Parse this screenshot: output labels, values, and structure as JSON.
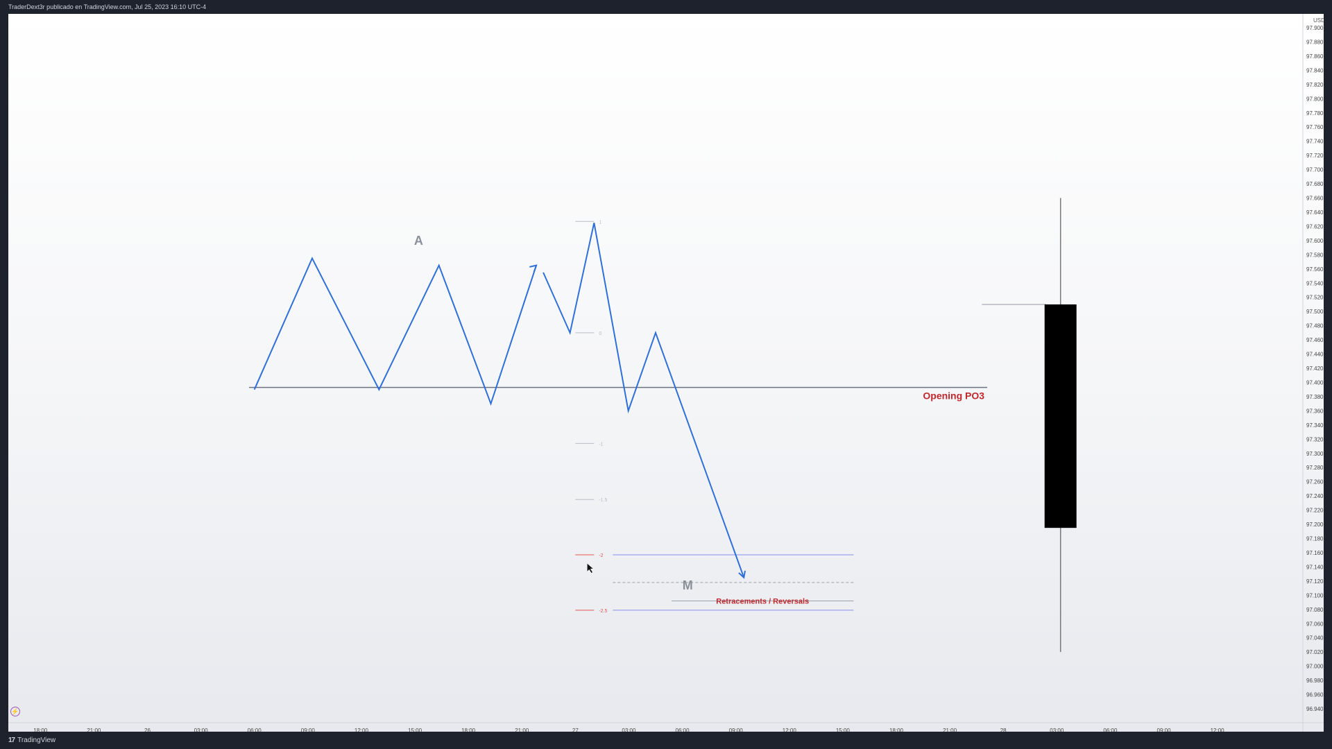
{
  "header": {
    "publish_text": "TraderDext3r publicado en TradingView.com, Jul 25, 2023 16:10 UTC-4"
  },
  "footer": {
    "brand": "TradingView",
    "logo_icon": "tradingview-logo-icon",
    "flash_icon": "lightning-icon"
  },
  "chart_data": {
    "type": "line",
    "currency": "USD",
    "y_ticks": [
      "97.900",
      "97.880",
      "97.860",
      "97.840",
      "97.820",
      "97.800",
      "97.780",
      "97.760",
      "97.740",
      "97.720",
      "97.700",
      "97.680",
      "97.660",
      "97.640",
      "97.620",
      "97.600",
      "97.580",
      "97.560",
      "97.540",
      "97.520",
      "97.500",
      "97.480",
      "97.460",
      "97.440",
      "97.420",
      "97.400",
      "97.380",
      "97.360",
      "97.340",
      "97.320",
      "97.300",
      "97.280",
      "97.260",
      "97.240",
      "97.220",
      "97.200",
      "97.180",
      "97.160",
      "97.140",
      "97.120",
      "97.100",
      "97.080",
      "97.060",
      "97.040",
      "97.020",
      "97.000",
      "96.980",
      "96.960",
      "96.940"
    ],
    "ylim": [
      96.94,
      97.9
    ],
    "x_ticks": [
      "18:00",
      "21:00",
      "26",
      "03:00",
      "06:00",
      "09:00",
      "12:00",
      "15:00",
      "18:00",
      "21:00",
      "27",
      "03:00",
      "06:00",
      "09:00",
      "12:00",
      "15:00",
      "18:00",
      "21:00",
      "28",
      "03:00",
      "06:00",
      "09:00",
      "12:00"
    ],
    "x_tick_index": [
      0,
      1,
      2,
      3,
      4,
      5,
      6,
      7,
      8,
      9,
      10,
      11,
      12,
      13,
      14,
      15,
      16,
      17,
      18,
      19,
      20,
      21,
      22
    ],
    "xlim": [
      -0.6,
      23.6
    ],
    "series": [
      {
        "color": "#2f6fd9",
        "points": [
          [
            4.0,
            97.39
          ],
          [
            5.08,
            97.575
          ],
          [
            6.33,
            97.39
          ],
          [
            7.45,
            97.565
          ],
          [
            8.42,
            97.37
          ],
          [
            9.27,
            97.565
          ]
        ]
      },
      {
        "color": "#2f6fd9",
        "points": [
          [
            9.4,
            97.555
          ],
          [
            9.9,
            97.47
          ],
          [
            10.35,
            97.625
          ],
          [
            10.99,
            97.36
          ],
          [
            11.5,
            97.47
          ],
          [
            13.15,
            97.125
          ]
        ]
      }
    ],
    "arrows": [
      {
        "from": [
          9.12,
          97.555
        ],
        "to": [
          9.27,
          97.565
        ]
      },
      {
        "from": [
          12.95,
          97.17
        ],
        "to": [
          13.15,
          97.125
        ]
      }
    ],
    "hlines": [
      {
        "y": 97.393,
        "x0": 3.9,
        "x1": 17.7,
        "color": "#6b7280",
        "label": "Opening PO3",
        "label_color": "#c0282d"
      }
    ],
    "fib_levels": [
      {
        "label": "1",
        "y": 97.627,
        "color": "#b8bcc4"
      },
      {
        "label": "0",
        "y": 97.47,
        "color": "#b8bcc4"
      },
      {
        "label": "-1",
        "y": 97.314,
        "color": "#b8bcc4"
      },
      {
        "label": "-1.5",
        "y": 97.235,
        "color": "#b8bcc4"
      },
      {
        "label": "-2",
        "y": 97.157,
        "color": "#e05555"
      },
      {
        "label": "-2.5",
        "y": 97.079,
        "color": "#e05555"
      }
    ],
    "fib_x": [
      10.0,
      10.35
    ],
    "zone_lines": [
      {
        "y": 97.157,
        "x0": 10.7,
        "x1": 15.2,
        "color": "#8c8ff0",
        "style": "solid"
      },
      {
        "y": 97.118,
        "x0": 10.7,
        "x1": 15.2,
        "color": "#9aa0a8",
        "style": "dashed"
      },
      {
        "y": 97.092,
        "x0": 11.8,
        "x1": 15.2,
        "color": "#9aa0a8",
        "style": "solid"
      },
      {
        "y": 97.079,
        "x0": 10.7,
        "x1": 15.2,
        "color": "#8c8ff0",
        "style": "solid"
      }
    ],
    "zone_label": {
      "text": "Retracements / Reversals",
      "x": 13.5,
      "y": 97.092,
      "color": "#c0282d"
    },
    "letters": [
      {
        "text": "A",
        "x": 7.07,
        "y": 97.6
      },
      {
        "text": "M",
        "x": 12.1,
        "y": 97.114
      }
    ],
    "candle": {
      "x": 19.07,
      "open": 97.51,
      "high": 97.66,
      "low": 97.02,
      "close": 97.195,
      "color": "#000000"
    },
    "faint_hline": {
      "y": 97.51,
      "x0": 17.6,
      "x1": 18.8
    },
    "cursor": {
      "x": 10.22,
      "y": 97.145
    }
  }
}
